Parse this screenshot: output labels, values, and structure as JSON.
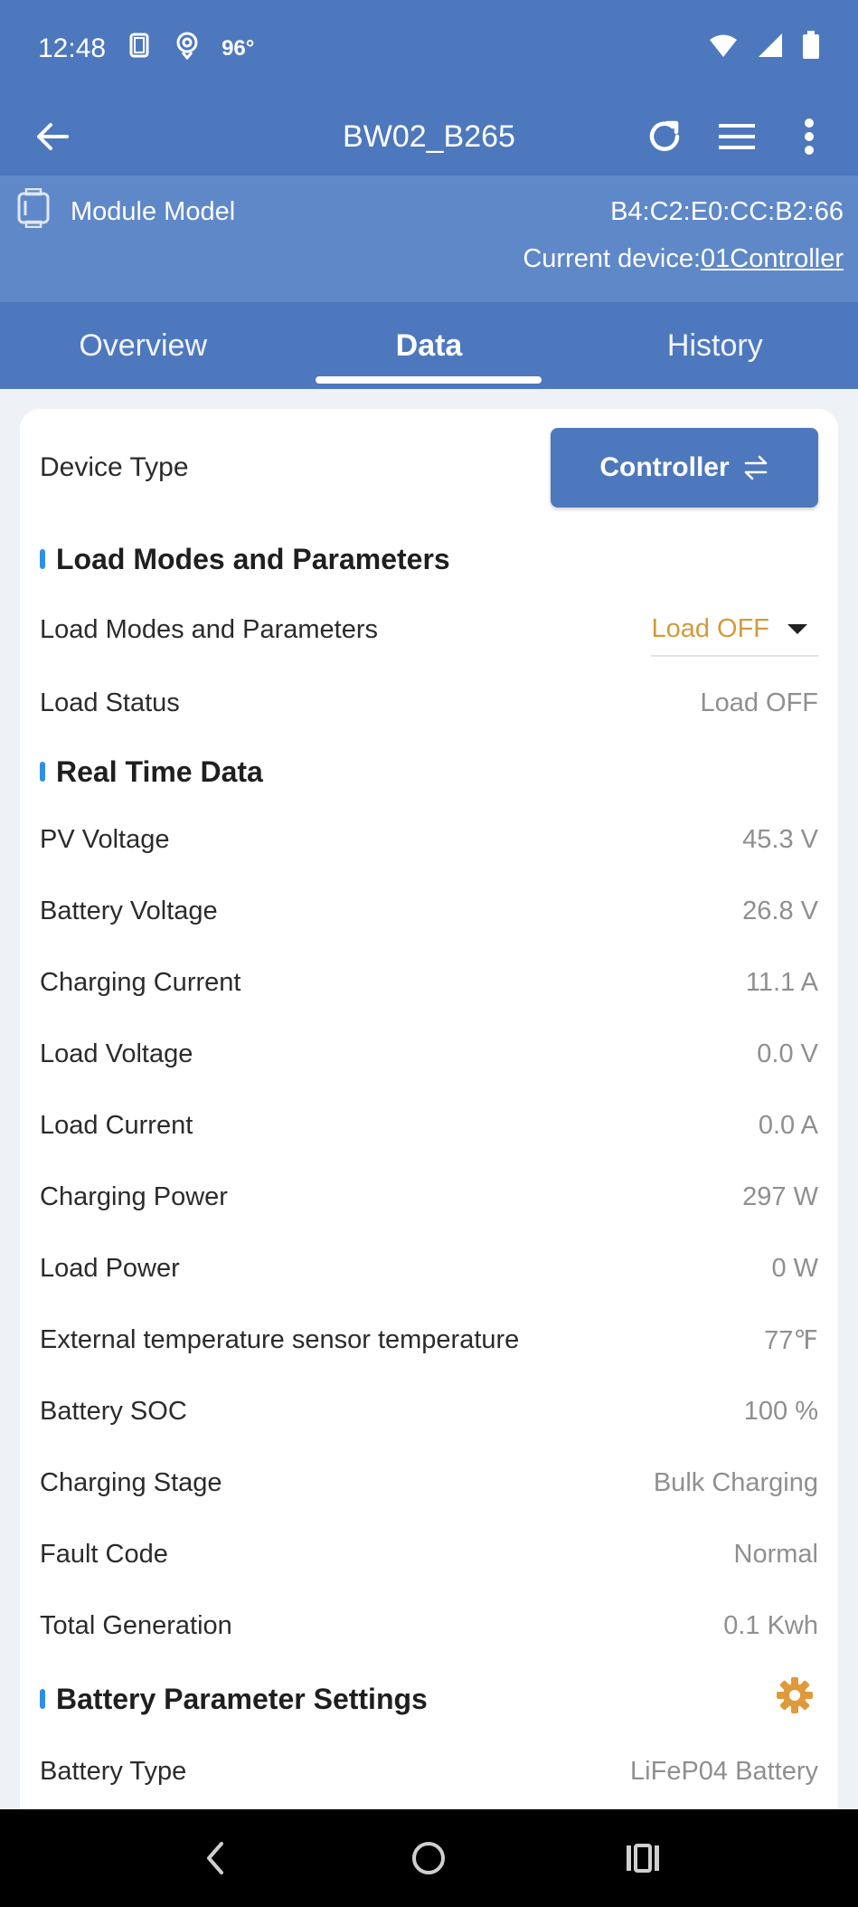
{
  "status_bar": {
    "time": "12:48",
    "temperature": "96°"
  },
  "app_bar": {
    "title": "BW02_B265"
  },
  "module": {
    "model_label": "Module Model",
    "mac": "B4:C2:E0:CC:B2:66",
    "current_device_label": "Current device:",
    "current_device_value": "01Controller"
  },
  "tabs": [
    {
      "label": "Overview",
      "active": false
    },
    {
      "label": "Data",
      "active": true
    },
    {
      "label": "History",
      "active": false
    }
  ],
  "device_type": {
    "label": "Device Type",
    "button_label": "Controller"
  },
  "load_section": {
    "title": "Load Modes and Parameters",
    "mode_label": "Load Modes and Parameters",
    "mode_value": "Load OFF",
    "status_label": "Load Status",
    "status_value": "Load OFF"
  },
  "realtime_section": {
    "title": "Real Time Data",
    "rows": [
      {
        "label": "PV Voltage",
        "value": "45.3 V"
      },
      {
        "label": "Battery Voltage",
        "value": "26.8 V"
      },
      {
        "label": "Charging Current",
        "value": "11.1 A"
      },
      {
        "label": "Load Voltage",
        "value": "0.0 V"
      },
      {
        "label": "Load Current",
        "value": "0.0 A"
      },
      {
        "label": "Charging Power",
        "value": "297 W"
      },
      {
        "label": "Load Power",
        "value": "0 W"
      },
      {
        "label": "External temperature sensor temperature",
        "value": "77℉"
      },
      {
        "label": "Battery SOC",
        "value": "100 %"
      },
      {
        "label": "Charging Stage",
        "value": "Bulk Charging"
      },
      {
        "label": "Fault Code",
        "value": "Normal"
      },
      {
        "label": "Total Generation",
        "value": "0.1 Kwh"
      }
    ]
  },
  "battery_section": {
    "title": "Battery Parameter Settings",
    "battery_type_label": "Battery Type",
    "battery_type_value": "LiFeP04 Battery"
  },
  "colors": {
    "primary": "#4e78bd",
    "module_bar": "#5f88c8",
    "accent_orange": "#d39a3a",
    "section_marker": "#2f8fe8"
  }
}
